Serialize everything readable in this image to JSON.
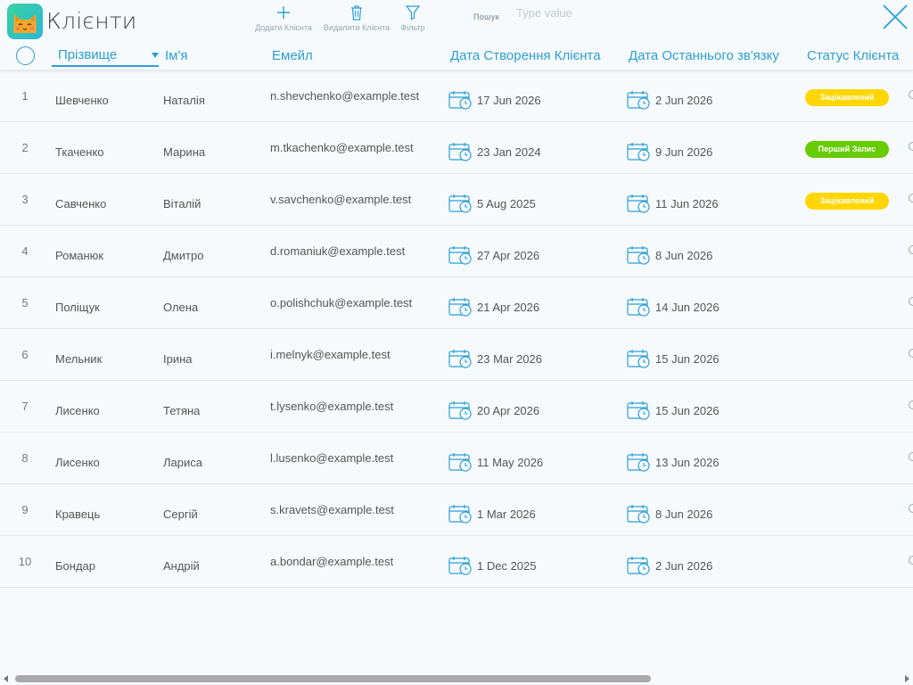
{
  "app": {
    "title": "Клієнти",
    "logo": "cat-face-icon"
  },
  "toolbar": {
    "add_label": "Додати Клієнта",
    "delete_label": "Видалити Клієнта",
    "filter_label": "Фільтр",
    "search_label": "Пошук",
    "search_placeholder": "Type value",
    "search_value": ""
  },
  "columns": {
    "last_name": "Прізвище",
    "first_name": "Ім'я",
    "email": "Емейл",
    "created": "Дата Створення Клієнта",
    "last_contact": "Дата Останнього зв'язку",
    "status": "Статус Клієнта"
  },
  "sort": {
    "column": "last_name",
    "direction": "desc"
  },
  "colors": {
    "accent": "#2a9fd6",
    "status_interested": "#ffd600",
    "status_first_record": "#66cc00"
  },
  "rows": [
    {
      "num": "1",
      "last": "Шевченко",
      "first": "Наталія",
      "email": "n.shevchenko@example.test",
      "created": "17 Jun 2026",
      "contact": "2 Jun 2026",
      "status": "Зацікавлений",
      "status_color": "#ffd600"
    },
    {
      "num": "2",
      "last": "Ткаченко",
      "first": "Марина",
      "email": "m.tkachenko@example.test",
      "created": "23 Jan 2024",
      "contact": "9 Jun 2026",
      "status": "Перший Запис",
      "status_color": "#66cc00"
    },
    {
      "num": "3",
      "last": "Савченко",
      "first": "Віталій",
      "email": "v.savchenko@example.test",
      "created": "5 Aug 2025",
      "contact": "11 Jun 2026",
      "status": "Зацікавлений",
      "status_color": "#ffd600"
    },
    {
      "num": "4",
      "last": "Романюк",
      "first": "Дмитро",
      "email": "d.romaniuk@example.test",
      "created": "27 Apr 2026",
      "contact": "8 Jun 2026",
      "status": "",
      "status_color": ""
    },
    {
      "num": "5",
      "last": "Поліщук",
      "first": "Олена",
      "email": "o.polishchuk@example.test",
      "created": "21 Apr 2026",
      "contact": "14 Jun 2026",
      "status": "",
      "status_color": ""
    },
    {
      "num": "6",
      "last": "Мельник",
      "first": "Ірина",
      "email": "i.melnyk@example.test",
      "created": "23 Mar 2026",
      "contact": "15 Jun 2026",
      "status": "",
      "status_color": ""
    },
    {
      "num": "7",
      "last": "Лисенко",
      "first": "Тетяна",
      "email": "t.lysenko@example.test",
      "created": "20 Apr 2026",
      "contact": "15 Jun 2026",
      "status": "",
      "status_color": ""
    },
    {
      "num": "8",
      "last": "Лисенко",
      "first": "Лариса",
      "email": "l.lusenko@example.test",
      "created": "11 May 2026",
      "contact": "13 Jun 2026",
      "status": "",
      "status_color": ""
    },
    {
      "num": "9",
      "last": "Кравець",
      "first": "Сергій",
      "email": "s.kravets@example.test",
      "created": "1 Mar 2026",
      "contact": "8 Jun 2026",
      "status": "",
      "status_color": ""
    },
    {
      "num": "10",
      "last": "Бондар",
      "first": "Андрій",
      "email": "a.bondar@example.test",
      "created": "1 Dec 2025",
      "contact": "2 Jun 2026",
      "status": "",
      "status_color": ""
    }
  ]
}
